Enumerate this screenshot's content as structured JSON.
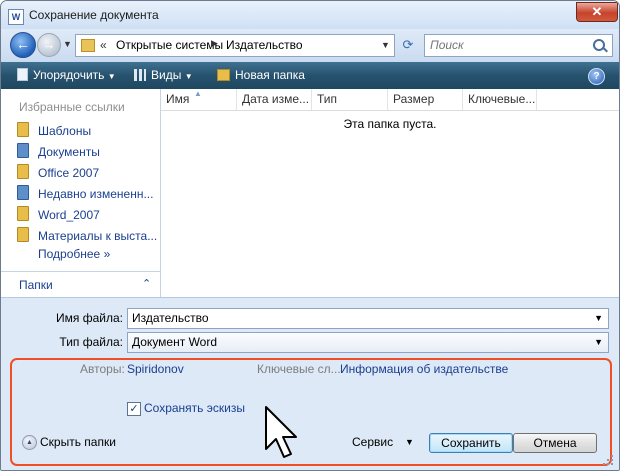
{
  "window": {
    "title": "Сохранение документа",
    "close_glyph": "✕",
    "app_icon_letter": "W"
  },
  "nav": {
    "back_glyph": "←",
    "forward_glyph": "→",
    "address": {
      "chevron": "«",
      "crumbs": [
        "Открытые системы",
        "Издательство"
      ],
      "separator": "▶"
    },
    "search_placeholder": "Поиск"
  },
  "toolbar": {
    "organize": "Упорядочить",
    "views": "Виды",
    "new_folder": "Новая папка",
    "help": "?"
  },
  "favorites": {
    "header": "Избранные ссылки",
    "items": [
      {
        "label": "Шаблоны",
        "icon": "folder-icon"
      },
      {
        "label": "Документы",
        "icon": "documents-icon"
      },
      {
        "label": "Office 2007",
        "icon": "folder-icon"
      },
      {
        "label": "Недавно измененн...",
        "icon": "recent-folder-icon"
      },
      {
        "label": "Word_2007",
        "icon": "folder-icon"
      },
      {
        "label": "Материалы к выста...",
        "icon": "folder-icon"
      }
    ],
    "more": "Подробнее  »"
  },
  "folders": {
    "label": "Папки",
    "chevron": "⌃"
  },
  "file_list": {
    "columns": [
      "Имя",
      "Дата изме...",
      "Тип",
      "Размер",
      "Ключевые..."
    ],
    "empty_message": "Эта папка пуста."
  },
  "form": {
    "filename_label": "Имя файла:",
    "filename_value": "Издательство",
    "filetype_label": "Тип файла:",
    "filetype_value": "Документ Word",
    "authors_label": "Авторы:",
    "authors_value": "Spiridonov",
    "keywords_label": "Ключевые сл...",
    "keywords_value": "Информация об издательстве",
    "save_thumbnails_label": "Сохранять эскизы",
    "save_thumbnails_checked": true,
    "hide_folders_label": "Скрыть папки",
    "tools_label": "Сервис",
    "save_button": "Сохранить",
    "cancel_button": "Отмена"
  },
  "colors": {
    "highlight": "#ee4f27",
    "link": "#1a3f8f",
    "toolbar": "#27526e"
  }
}
